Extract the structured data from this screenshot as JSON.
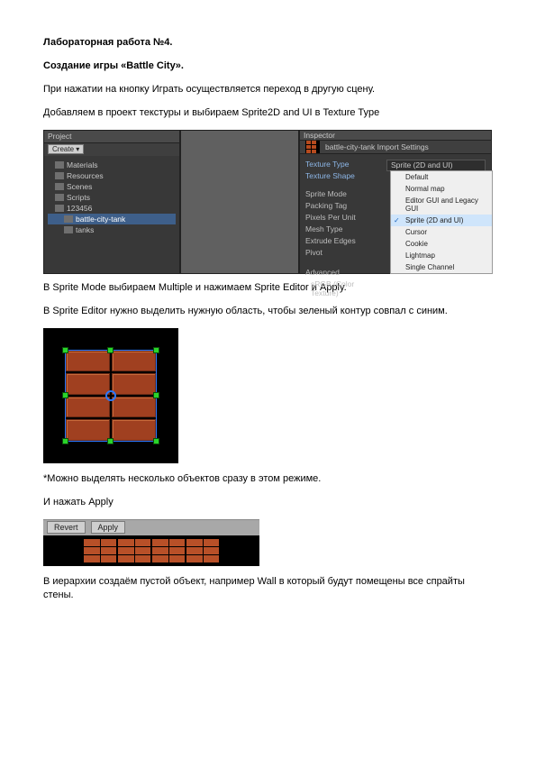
{
  "paragraphs": {
    "title": "Лабораторная работа №4.",
    "subtitle": "Создание игры «Battle City».",
    "p1": "При нажатии на кнопку Играть осуществляется переход в другую сцену.",
    "p2": "Добавляем в проект текстуры и выбираем Sprite2D and UI в Texture Type",
    "p3": "В Sprite Mode выбираем Multiple и нажимаем Sprite Editor и Apply.",
    "p4": "В Sprite Editor нужно выделить нужную область, чтобы зеленый контур совпал с синим.",
    "p5": "*Можно выделять несколько объектов сразу в этом режиме.",
    "p6": "И нажать Apply",
    "p7": "В иерархии создаём пустой объект, например Wall в который будут помещены все спрайты стены."
  },
  "shot1": {
    "projectTab": "Project",
    "createBtn": "Create ▾",
    "tree": [
      {
        "label": "Materials",
        "indent": false,
        "selected": false
      },
      {
        "label": "Resources",
        "indent": false,
        "selected": false
      },
      {
        "label": "Scenes",
        "indent": false,
        "selected": false
      },
      {
        "label": "Scripts",
        "indent": false,
        "selected": false
      },
      {
        "label": "123456",
        "indent": false,
        "selected": false
      },
      {
        "label": "battle-city-tank",
        "indent": true,
        "selected": true
      },
      {
        "label": "tanks",
        "indent": true,
        "selected": false
      }
    ],
    "inspectorTab": "Inspector",
    "assetTitle": "battle-city-tank Import Settings",
    "labels": {
      "textureType": "Texture Type",
      "textureShape": "Texture Shape",
      "spriteMode": "Sprite Mode",
      "packingTag": "Packing Tag",
      "ppu": "Pixels Per Unit",
      "meshType": "Mesh Type",
      "extrude": "Extrude Edges",
      "pivot": "Pivot",
      "advanced": "Advanced",
      "srgb": "sRGB (Color Texture)"
    },
    "ddSelected": "Sprite (2D and UI)",
    "ddOptions": [
      "Default",
      "Normal map",
      "Editor GUI and Legacy GUI",
      "Sprite (2D and UI)",
      "Cursor",
      "Cookie",
      "Lightmap",
      "Single Channel"
    ],
    "ddSelectedIndex": 3
  },
  "shot3": {
    "revert": "Revert",
    "apply": "Apply"
  }
}
